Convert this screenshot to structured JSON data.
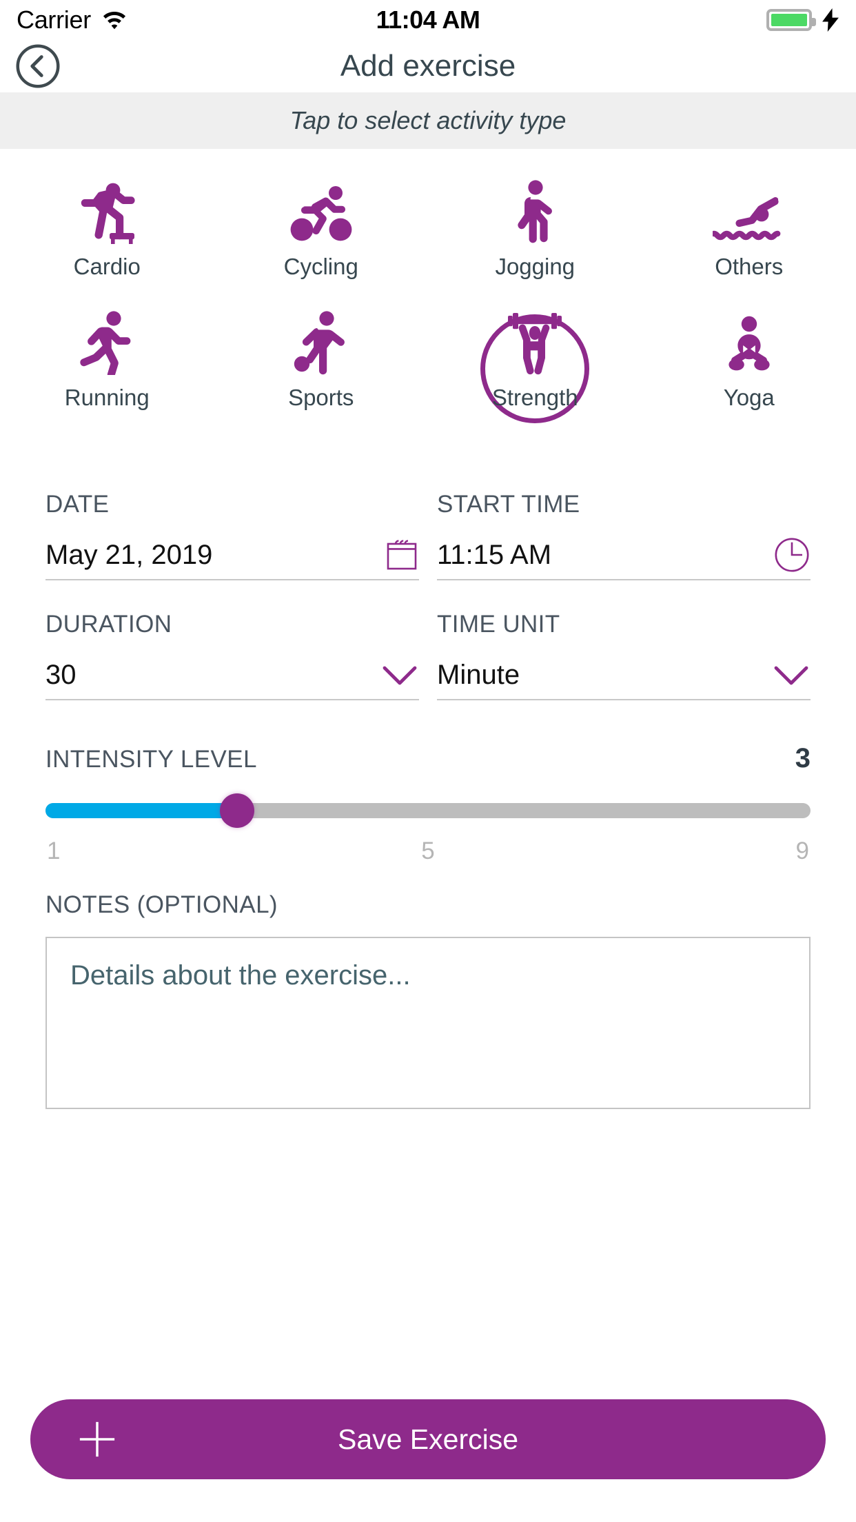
{
  "status_bar": {
    "carrier": "Carrier",
    "time": "11:04 AM",
    "wifi_icon": "wifi-icon",
    "battery_icon": "battery-icon",
    "charging_icon": "lightning-bolt-icon",
    "battery_color": "#4cd964"
  },
  "nav": {
    "title": "Add exercise",
    "back_icon": "chevron-left-circle-icon"
  },
  "banner": {
    "hint": "Tap to select activity type"
  },
  "activities": {
    "row1": [
      {
        "label": "Cardio",
        "icon": "cardio-step-icon",
        "selected": false
      },
      {
        "label": "Cycling",
        "icon": "cycling-icon",
        "selected": false
      },
      {
        "label": "Jogging",
        "icon": "jogging-icon",
        "selected": false
      },
      {
        "label": "Others",
        "icon": "swimming-icon",
        "selected": false
      }
    ],
    "row2": [
      {
        "label": "Running",
        "icon": "running-icon",
        "selected": false
      },
      {
        "label": "Sports",
        "icon": "soccer-icon",
        "selected": false
      },
      {
        "label": "Strength",
        "icon": "weightlifting-icon",
        "selected": true
      },
      {
        "label": "Yoga",
        "icon": "yoga-lotus-icon",
        "selected": false
      }
    ]
  },
  "fields": {
    "date": {
      "label": "DATE",
      "value": "May 21, 2019",
      "icon": "calendar-icon"
    },
    "start_time": {
      "label": "START TIME",
      "value": "11:15 AM",
      "icon": "clock-icon"
    },
    "duration": {
      "label": "DURATION",
      "value": "30",
      "icon": "chevron-down-icon"
    },
    "time_unit": {
      "label": "TIME UNIT",
      "value": "Minute",
      "icon": "chevron-down-icon"
    }
  },
  "intensity": {
    "label": "INTENSITY LEVEL",
    "value": "3",
    "min": "1",
    "mid": "5",
    "max": "9",
    "fill_percent": 25,
    "track_color": "#bdbdbd",
    "fill_color": "#00a9e6",
    "thumb_color": "#8e2a8b"
  },
  "notes": {
    "label": "NOTES (OPTIONAL)",
    "placeholder": "Details about the exercise...",
    "value": ""
  },
  "save": {
    "label": "Save Exercise",
    "icon": "plus-icon",
    "color": "#8e2a8b"
  },
  "theme": {
    "accent_purple": "#8e2a8b",
    "text_slate": "#37474f",
    "banner_gray": "#efefef"
  }
}
